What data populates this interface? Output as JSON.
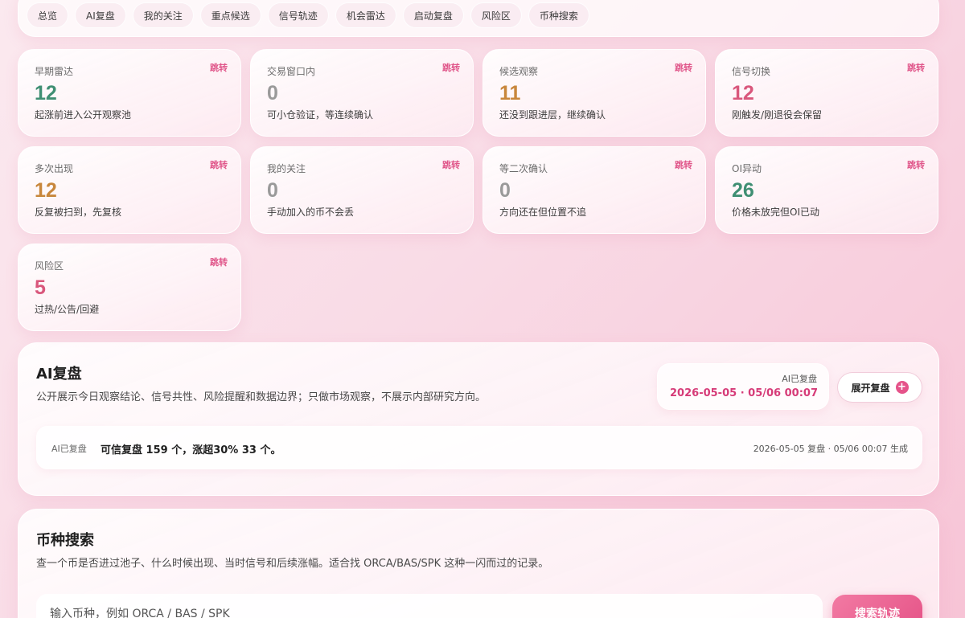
{
  "colors": {
    "accent": "#e5538a",
    "green": "#3f8f73",
    "gray": "#9a9a9a",
    "gold": "#c8873c",
    "rose": "#d9577c"
  },
  "nav": {
    "tabs": [
      "总览",
      "AI复盘",
      "我的关注",
      "重点候选",
      "信号轨迹",
      "机会雷达",
      "启动复盘",
      "风险区",
      "币种搜索"
    ]
  },
  "cards": [
    {
      "title": "早期雷达",
      "jump": "跳转",
      "value": "12",
      "desc": "起涨前进入公开观察池",
      "color": "#3f8f73"
    },
    {
      "title": "交易窗口内",
      "jump": "跳转",
      "value": "0",
      "desc": "可小仓验证，等连续确认",
      "color": "#9a9a9a"
    },
    {
      "title": "候选观察",
      "jump": "跳转",
      "value": "11",
      "desc": "还没到跟进层，继续确认",
      "color": "#c8873c"
    },
    {
      "title": "信号切换",
      "jump": "跳转",
      "value": "12",
      "desc": "刚触发/刚退役会保留",
      "color": "#d9577c"
    },
    {
      "title": "多次出现",
      "jump": "跳转",
      "value": "12",
      "desc": "反复被扫到，先复核",
      "color": "#c8873c"
    },
    {
      "title": "我的关注",
      "jump": "跳转",
      "value": "0",
      "desc": "手动加入的币不会丢",
      "color": "#9a9a9a"
    },
    {
      "title": "等二次确认",
      "jump": "跳转",
      "value": "0",
      "desc": "方向还在但位置不追",
      "color": "#9a9a9a"
    },
    {
      "title": "OI异动",
      "jump": "跳转",
      "value": "26",
      "desc": "价格未放完但OI已动",
      "color": "#3f8f73"
    },
    {
      "title": "风险区",
      "jump": "跳转",
      "value": "5",
      "desc": "过热/公告/回避",
      "color": "#d9577c"
    }
  ],
  "ai_review": {
    "title": "AI复盘",
    "subtitle": "公开展示今日观察结论、信号共性、风险提醒和数据边界；只做市场观察，不展示内部研究方向。",
    "status_label": "AI已复盘",
    "status_time": "2026-05-05 · 05/06 00:07",
    "expand_label": "展开复盘",
    "row_tag": "AI已复盘",
    "row_text": "可信复盘 159 个，涨超30% 33 个。",
    "row_meta": "2026-05-05 复盘 · 05/06 00:07 生成"
  },
  "coin_search": {
    "title": "币种搜索",
    "subtitle": "查一个币是否进过池子、什么时候出现、当时信号和后续涨幅。适合找 ORCA/BAS/SPK 这种一闪而过的记录。",
    "placeholder": "输入币种，例如 ORCA / BAS / SPK",
    "button_label": "搜索轨迹"
  }
}
